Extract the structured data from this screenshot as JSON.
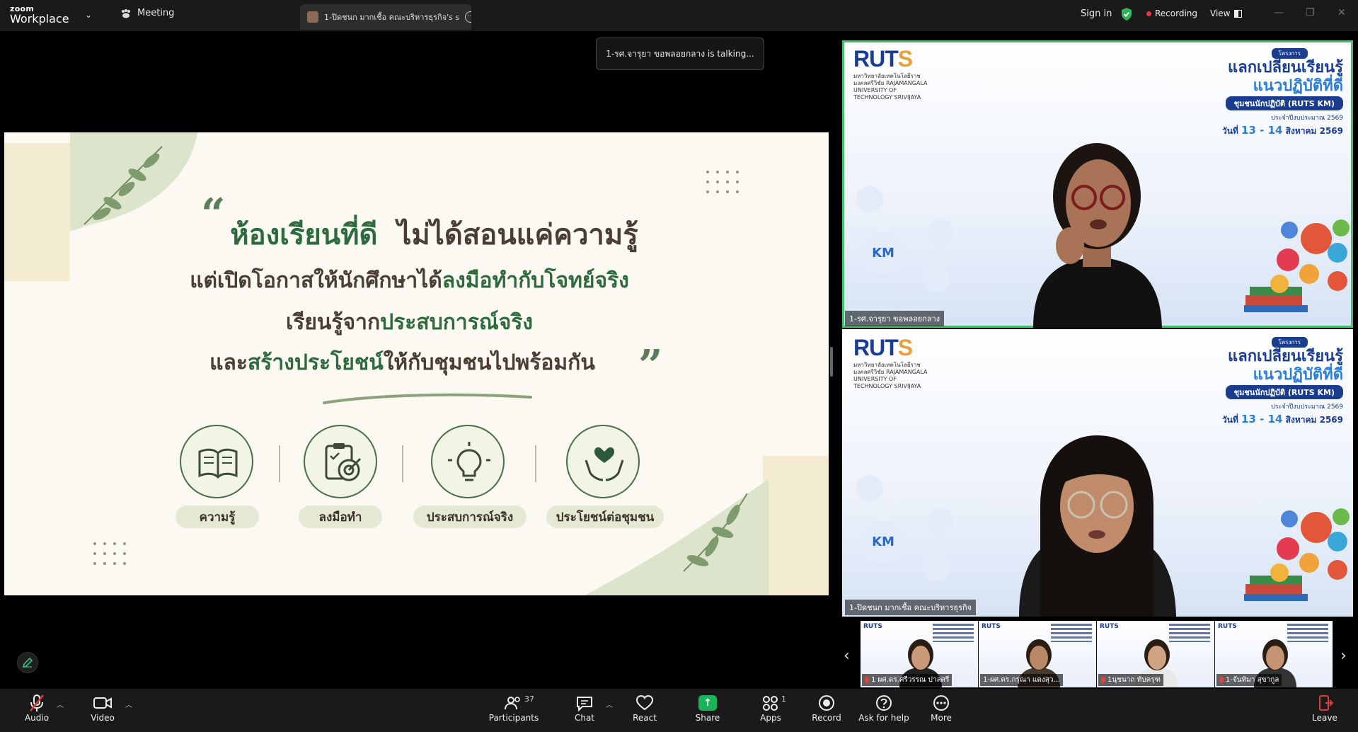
{
  "app": {
    "logo_top": "zoom",
    "logo_bottom": "Workplace"
  },
  "topbar": {
    "meeting_label": "Meeting",
    "tab_label": "1-ปิดชนก มากเชื้อ คณะบริหารธุรกิจ's s",
    "signin": "Sign in",
    "recording": "Recording",
    "view": "View"
  },
  "talking": "1-รศ.จารุยา ขอพลอยกลาง is talking...",
  "slide": {
    "line1a": "ห้องเรียนที่ดี",
    "line1b": "ไม่ได้สอนแค่ความรู้",
    "line2a": "แต่เปิดโอกาสให้นักศึกษาได้",
    "line2b": "ลงมือทำกับโจทย์จริง",
    "line3a": "เรียนรู้จาก",
    "line3b": "ประสบการณ์จริง",
    "line4a": "และ",
    "line4b": "สร้างประโยชน์",
    "line4c": "ให้กับชุมชนไปพร้อมกัน",
    "pills": [
      "ความรู้",
      "ลงมือทำ",
      "ประสบการณ์จริง",
      "ประโยชน์ต่อชุมชน"
    ]
  },
  "tile_bg": {
    "logo": "RUTS",
    "uni": "มหาวิทยาลัยเทคโนโลยีราชมงคลศรีวิชัย RAJAMANGALA UNIVERSITY OF TECHNOLOGY SRIVIJAYA",
    "tag": "โครงการ",
    "title1": "แลกเปลี่ยนเรียนรู้",
    "title2": "แนวปฏิบัติที่ดี",
    "band": "ชุมชนนักปฏิบัติ (RUTS KM)",
    "meta": "ประจำปีงบประมาณ 2569",
    "date_pre": "วันที่",
    "date_days": "13 - 14",
    "date_post": "สิงหาคม 2569",
    "km": "KM"
  },
  "tiles": [
    {
      "name": "1-รศ.จารุยา ขอพลอยกลาง"
    },
    {
      "name": "1-ปิดชนก มากเชื้อ คณะบริหารธุรกิจ"
    }
  ],
  "thumbnails": [
    {
      "name": "1 ผศ.ดร.ศรีวรรณ ปาลศรี"
    },
    {
      "name": "1-ผศ.ดร.กรุณา แดงสุว..."
    },
    {
      "name": "1นุชนาถ ทับครุฑ"
    },
    {
      "name": "1-จันทิมา สุขากูล"
    }
  ],
  "toolbar": {
    "audio": "Audio",
    "video": "Video",
    "participants": "Participants",
    "participants_count": "37",
    "chat": "Chat",
    "react": "React",
    "share": "Share",
    "apps": "Apps",
    "apps_count": "1",
    "record": "Record",
    "help": "Ask for help",
    "more": "More",
    "leave": "Leave"
  },
  "colors": {
    "green_accent": "#2d6b3e",
    "toolbar_bg": "#1a1a1a",
    "active_speaker": "#43c06a",
    "brand_blue": "#1b3d8f"
  }
}
